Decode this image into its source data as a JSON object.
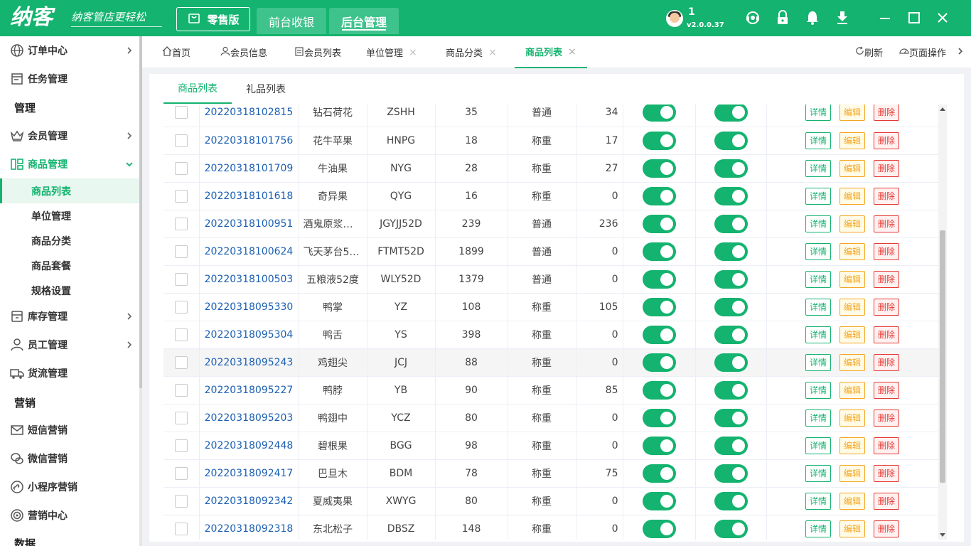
{
  "brand": {
    "name": "纳客",
    "slogan": "纳客管店更轻松"
  },
  "topbar": {
    "edition_label": "零售版",
    "tabs": [
      "前台收银",
      "后台管理"
    ],
    "user_name": "1",
    "version": "v2.0.0.37"
  },
  "sidebar": {
    "items": [
      {
        "label": "订单中心"
      },
      {
        "label": "任务管理"
      },
      {
        "section": "管理"
      },
      {
        "label": "会员管理"
      },
      {
        "label": "商品管理"
      },
      {
        "sub": "商品列表"
      },
      {
        "sub": "单位管理"
      },
      {
        "sub": "商品分类"
      },
      {
        "sub": "商品套餐"
      },
      {
        "sub": "规格设置"
      },
      {
        "label": "库存管理"
      },
      {
        "label": "员工管理"
      },
      {
        "label": "货流管理"
      },
      {
        "section": "营销"
      },
      {
        "label": "短信营销"
      },
      {
        "label": "微信营销"
      },
      {
        "label": "小程序营销"
      },
      {
        "label": "营销中心"
      },
      {
        "section": "数据"
      }
    ]
  },
  "page_tabs": [
    {
      "label": "首页"
    },
    {
      "label": "会员信息"
    },
    {
      "label": "会员列表"
    },
    {
      "label": "单位管理",
      "close": "×"
    },
    {
      "label": "商品分类",
      "close": "×"
    },
    {
      "label": "商品列表",
      "close": "×"
    }
  ],
  "page_actions": {
    "refresh": "刷新",
    "page_ops": "页面操作"
  },
  "sub_tabs": [
    "商品列表",
    "礼品列表"
  ],
  "actions": {
    "detail": "详情",
    "edit": "编辑",
    "delete": "删除"
  },
  "colors": {
    "brand": "#14b36f",
    "link": "#1a5fb4",
    "edit": "#f5a623",
    "delete": "#e53935"
  },
  "products": [
    {
      "code": "20220318102815",
      "name": "钻石荷花",
      "abbr": "ZSHH",
      "price": "35",
      "type": "普通",
      "stock": "34"
    },
    {
      "code": "20220318101756",
      "name": "花牛苹果",
      "abbr": "HNPG",
      "price": "18",
      "type": "称重",
      "stock": "17"
    },
    {
      "code": "20220318101709",
      "name": "牛油果",
      "abbr": "NYG",
      "price": "28",
      "type": "称重",
      "stock": "27"
    },
    {
      "code": "20220318101618",
      "name": "奇异果",
      "abbr": "QYG",
      "price": "16",
      "type": "称重",
      "stock": "0"
    },
    {
      "code": "20220318100951",
      "name": "酒鬼原浆酒...",
      "abbr": "JGYJJ52D",
      "price": "239",
      "type": "普通",
      "stock": "236"
    },
    {
      "code": "20220318100624",
      "name": "飞天茅台52...",
      "abbr": "FTMT52D",
      "price": "1899",
      "type": "普通",
      "stock": "0"
    },
    {
      "code": "20220318100503",
      "name": "五粮液52度",
      "abbr": "WLY52D",
      "price": "1379",
      "type": "普通",
      "stock": "0"
    },
    {
      "code": "20220318095330",
      "name": "鸭掌",
      "abbr": "YZ",
      "price": "108",
      "type": "称重",
      "stock": "105"
    },
    {
      "code": "20220318095304",
      "name": "鸭舌",
      "abbr": "YS",
      "price": "398",
      "type": "称重",
      "stock": "0"
    },
    {
      "code": "20220318095243",
      "name": "鸡翅尖",
      "abbr": "JCJ",
      "price": "88",
      "type": "称重",
      "stock": "0"
    },
    {
      "code": "20220318095227",
      "name": "鸭脖",
      "abbr": "YB",
      "price": "90",
      "type": "称重",
      "stock": "85"
    },
    {
      "code": "20220318095203",
      "name": "鸭翅中",
      "abbr": "YCZ",
      "price": "80",
      "type": "称重",
      "stock": "0"
    },
    {
      "code": "20220318092448",
      "name": "碧根果",
      "abbr": "BGG",
      "price": "98",
      "type": "称重",
      "stock": "0"
    },
    {
      "code": "20220318092417",
      "name": "巴旦木",
      "abbr": "BDM",
      "price": "78",
      "type": "称重",
      "stock": "75"
    },
    {
      "code": "20220318092342",
      "name": "夏威夷果",
      "abbr": "XWYG",
      "price": "80",
      "type": "称重",
      "stock": "0"
    },
    {
      "code": "20220318092318",
      "name": "东北松子",
      "abbr": "DBSZ",
      "price": "148",
      "type": "称重",
      "stock": "0"
    }
  ]
}
